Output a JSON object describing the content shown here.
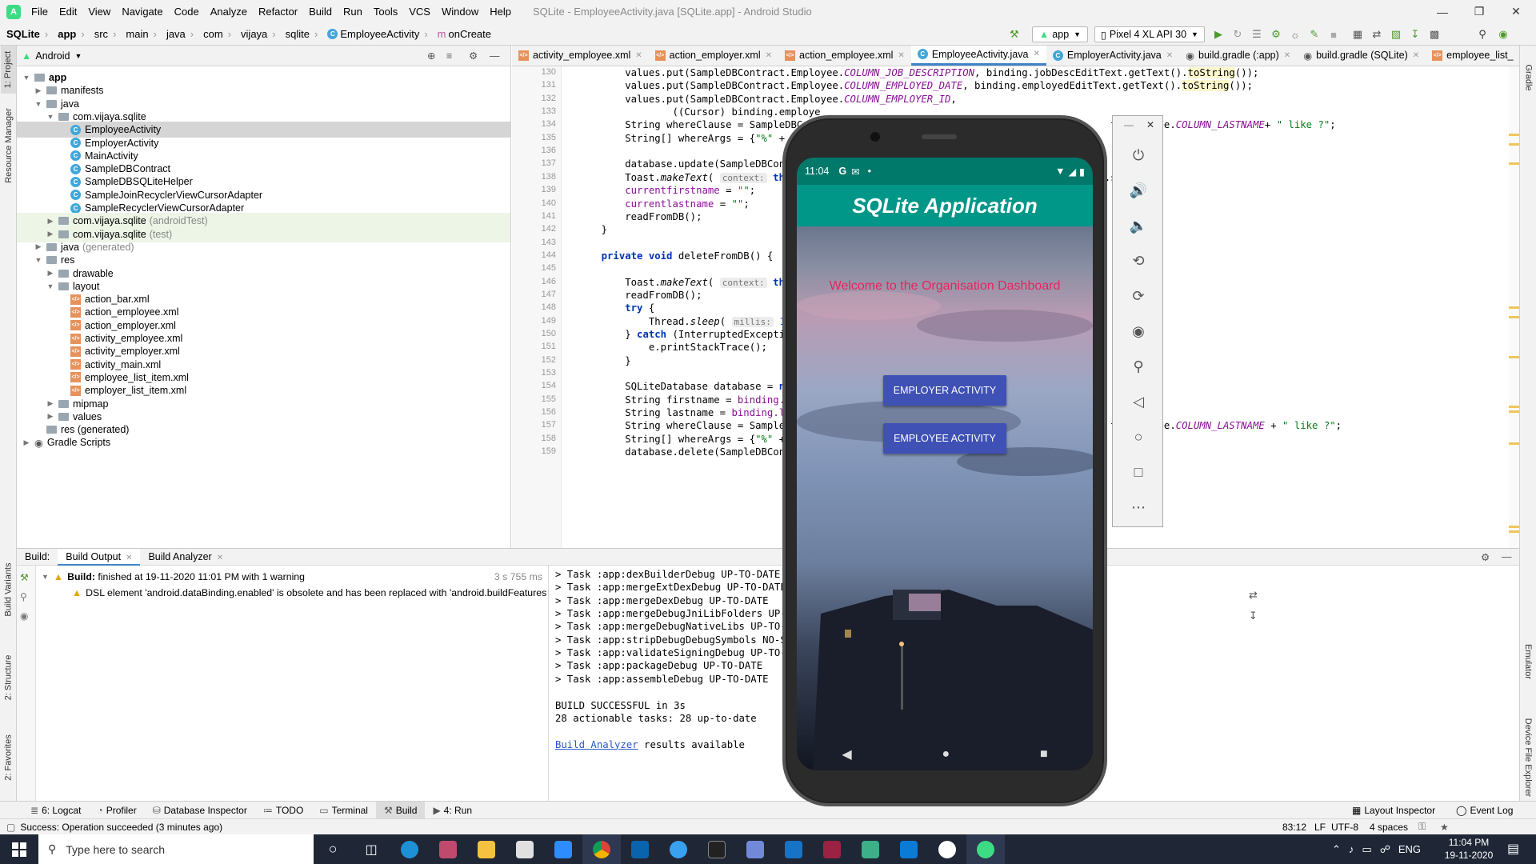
{
  "menubar": {
    "items": [
      "File",
      "Edit",
      "View",
      "Navigate",
      "Code",
      "Analyze",
      "Refactor",
      "Build",
      "Run",
      "Tools",
      "VCS",
      "Window",
      "Help"
    ],
    "window_title": "SQLite - EmployeeActivity.java [SQLite.app] - Android Studio"
  },
  "breadcrumb": [
    "SQLite",
    "app",
    "src",
    "main",
    "java",
    "com",
    "vijaya",
    "sqlite",
    "EmployeeActivity",
    "onCreate"
  ],
  "toolbar": {
    "run_config": "app",
    "device": "Pixel 4 XL API 30"
  },
  "project_panel": {
    "view": "Android",
    "tree": [
      {
        "label": "app",
        "depth": 0,
        "kind": "folder",
        "open": true
      },
      {
        "label": "manifests",
        "depth": 1,
        "kind": "folder"
      },
      {
        "label": "java",
        "depth": 1,
        "kind": "folder",
        "open": true
      },
      {
        "label": "com.vijaya.sqlite",
        "depth": 2,
        "kind": "folder",
        "open": true
      },
      {
        "label": "EmployeeActivity",
        "depth": 3,
        "kind": "class",
        "selected": true
      },
      {
        "label": "EmployerActivity",
        "depth": 3,
        "kind": "class"
      },
      {
        "label": "MainActivity",
        "depth": 3,
        "kind": "class"
      },
      {
        "label": "SampleDBContract",
        "depth": 3,
        "kind": "class"
      },
      {
        "label": "SampleDBSQLiteHelper",
        "depth": 3,
        "kind": "class"
      },
      {
        "label": "SampleJoinRecyclerViewCursorAdapter",
        "depth": 3,
        "kind": "class"
      },
      {
        "label": "SampleRecyclerViewCursorAdapter",
        "depth": 3,
        "kind": "class"
      },
      {
        "label": "com.vijaya.sqlite",
        "suffix": "(androidTest)",
        "depth": 2,
        "kind": "folder",
        "hl": true
      },
      {
        "label": "com.vijaya.sqlite",
        "suffix": "(test)",
        "depth": 2,
        "kind": "folder",
        "hl": true
      },
      {
        "label": "java",
        "suffix": "(generated)",
        "depth": 1,
        "kind": "folder"
      },
      {
        "label": "res",
        "depth": 1,
        "kind": "folder",
        "open": true
      },
      {
        "label": "drawable",
        "depth": 2,
        "kind": "folder"
      },
      {
        "label": "layout",
        "depth": 2,
        "kind": "folder",
        "open": true
      },
      {
        "label": "action_bar.xml",
        "depth": 3,
        "kind": "xml"
      },
      {
        "label": "action_employee.xml",
        "depth": 3,
        "kind": "xml"
      },
      {
        "label": "action_employer.xml",
        "depth": 3,
        "kind": "xml"
      },
      {
        "label": "activity_employee.xml",
        "depth": 3,
        "kind": "xml"
      },
      {
        "label": "activity_employer.xml",
        "depth": 3,
        "kind": "xml"
      },
      {
        "label": "activity_main.xml",
        "depth": 3,
        "kind": "xml"
      },
      {
        "label": "employee_list_item.xml",
        "depth": 3,
        "kind": "xml"
      },
      {
        "label": "employer_list_item.xml",
        "depth": 3,
        "kind": "xml"
      },
      {
        "label": "mipmap",
        "depth": 2,
        "kind": "folder"
      },
      {
        "label": "values",
        "depth": 2,
        "kind": "folder"
      },
      {
        "label": "res (generated)",
        "depth": 1,
        "kind": "folder",
        "noarrow": true
      },
      {
        "label": "Gradle Scripts",
        "depth": 0,
        "kind": "gradle"
      }
    ]
  },
  "editor": {
    "tabs": [
      "activity_employee.xml",
      "action_employer.xml",
      "action_employee.xml",
      "EmployeeActivity.java",
      "EmployerActivity.java",
      "build.gradle (:app)",
      "build.gradle (SQLite)",
      "employee_list_"
    ],
    "active_tab": 3,
    "lines": [
      {
        "n": "130",
        "html": "        values.put(SampleDBContract.Employee.<span class=\"fld\">COLUMN_JOB_DESCRIPTION</span>, binding.jobDescEditText.getText().<span class=\"ts\">toString</span>());"
      },
      {
        "n": "131",
        "html": "        values.put(SampleDBContract.Employee.<span class=\"fld\">COLUMN_EMPLOYED_DATE</span>, binding.employedEditText.getText().<span class=\"ts\">toString</span>());"
      },
      {
        "n": "132",
        "html": "        values.put(SampleDBContract.Employee.<span class=\"fld\">COLUMN_EMPLOYER_ID</span>,"
      },
      {
        "n": "133",
        "html": "                ((Cursor) binding.employe"
      },
      {
        "n": "134",
        "html": "        String whereClause = SampleDBCo                                                   t.Employee.<span class=\"fld\">COLUMN_LASTNAME</span>+ <span class=\"str\">\" like ?\"</span>;"
      },
      {
        "n": "135",
        "html": "        String[] whereArgs = {<span class=\"str\">\"%\"</span> + cur"
      },
      {
        "n": "136",
        "html": ""
      },
      {
        "n": "137",
        "html": "        database.update(SampleDBContrac"
      },
      {
        "n": "138",
        "html": "        Toast.<span class=\"meth\">makeText</span>( <span class=\"hint\">context:</span> <span class=\"kw\">this</span>,                                          <span class=\"fld\">GTH_LONG</span>).show();"
      },
      {
        "n": "139",
        "html": "        <span class=\"fld\" style=\"font-style:normal\">currentfirstname</span> = <span class=\"str\">\"\"</span>;"
      },
      {
        "n": "140",
        "html": "        <span class=\"fld\" style=\"font-style:normal\">currentlastname</span> = <span class=\"str\">\"\"</span>;"
      },
      {
        "n": "141",
        "html": "        readFromDB();"
      },
      {
        "n": "142",
        "html": "    }"
      },
      {
        "n": "143",
        "html": ""
      },
      {
        "n": "144",
        "html": "    <span class=\"kw\">private void</span> deleteFromDB() {"
      },
      {
        "n": "145",
        "html": ""
      },
      {
        "n": "146",
        "html": "        Toast.<span class=\"meth\">makeText</span>( <span class=\"hint\">context:</span> <span class=\"kw\">this</span>,"
      },
      {
        "n": "147",
        "html": "        readFromDB();"
      },
      {
        "n": "148",
        "html": "        <span class=\"kw\">try</span> {"
      },
      {
        "n": "149",
        "html": "            Thread.<span class=\"meth\">sleep</span>( <span class=\"hint\">millis:</span> <span class=\"num\">1500</span>);"
      },
      {
        "n": "150",
        "html": "        } <span class=\"kw\">catch</span> (InterruptedException e"
      },
      {
        "n": "151",
        "html": "            e.printStackTrace();"
      },
      {
        "n": "152",
        "html": "        }"
      },
      {
        "n": "153",
        "html": ""
      },
      {
        "n": "154",
        "html": "        SQLiteDatabase database = <span class=\"kw\">new</span> S"
      },
      {
        "n": "155",
        "html": "        String firstname = <span class=\"kw\" style=\"font-weight:normal;color:#871094\">binding.firs</span>"
      },
      {
        "n": "156",
        "html": "        String lastname = <span class=\"kw\" style=\"font-weight:normal;color:#871094\">binding.lastn</span>"
      },
      {
        "n": "157",
        "html": "        String whereClause = SampleDBCo                                                   t.Employee.<span class=\"fld\">COLUMN_LASTNAME</span> + <span class=\"str\">\" like ?\"</span>;"
      },
      {
        "n": "158",
        "html": "        String[] whereArgs = {<span class=\"str\">\"%\"</span> + fir"
      },
      {
        "n": "159",
        "html": "        database.delete(SampleDBContrac"
      }
    ]
  },
  "build": {
    "tabs": [
      "Build:",
      "Build Output",
      "Build Analyzer"
    ],
    "tree_line1_bold": "Build:",
    "tree_line1": "finished at 19-11-2020 11:01 PM with 1 warning",
    "tree_line1_time": "3 s 755 ms",
    "tree_line2": "DSL element 'android.dataBinding.enabled' is obsolete and has been replaced with 'android.buildFeatures",
    "output": [
      "> Task :app:dexBuilderDebug UP-TO-DATE",
      "> Task :app:mergeExtDexDebug UP-TO-DATE",
      "> Task :app:mergeDexDebug UP-TO-DATE",
      "> Task :app:mergeDebugJniLibFolders UP-TO-DA",
      "> Task :app:mergeDebugNativeLibs UP-TO-DATE",
      "> Task :app:stripDebugDebugSymbols NO-SOURCE",
      "> Task :app:validateSigningDebug UP-TO-DATE",
      "> Task :app:packageDebug UP-TO-DATE",
      "> Task :app:assembleDebug UP-TO-DATE",
      "",
      "BUILD SUCCESSFUL in 3s",
      "28 actionable tasks: 28 up-to-date",
      ""
    ],
    "analyzer_link": "Build Analyzer",
    "analyzer_rest": " results available"
  },
  "toolwindows": [
    "6: Logcat",
    "Profiler",
    "Database Inspector",
    "TODO",
    "Terminal",
    "Build",
    "4: Run"
  ],
  "toolwindows_right": [
    "Layout Inspector",
    "Event Log"
  ],
  "left_vtabs": [
    "1: Project",
    "Resource Manager",
    "Build Variants",
    "2: Structure",
    "2: Favorites"
  ],
  "right_vtabs": [
    "Gradle",
    "Emulator",
    "Device File Explorer"
  ],
  "status": {
    "message": "Success: Operation succeeded (3 minutes ago)",
    "pos": "83:12",
    "eol": "LF",
    "enc": "UTF-8",
    "indent": "4 spaces"
  },
  "emulator": {
    "time": "11:04",
    "app_title": "SQLite Application",
    "welcome": "Welcome to the Organisation Dashboard",
    "btn1": "EMPLOYER ACTIVITY",
    "btn2": "EMPLOYEE ACTIVITY"
  },
  "taskbar": {
    "search_placeholder": "Type here to search",
    "time": "11:04 PM",
    "date": "19-11-2020",
    "lang": "ENG"
  },
  "colors": {
    "accent": "#4083c9",
    "app_bar": "#009688",
    "status_bar": "#00796b",
    "button": "#3f51b5",
    "welcome": "#e8255f"
  }
}
